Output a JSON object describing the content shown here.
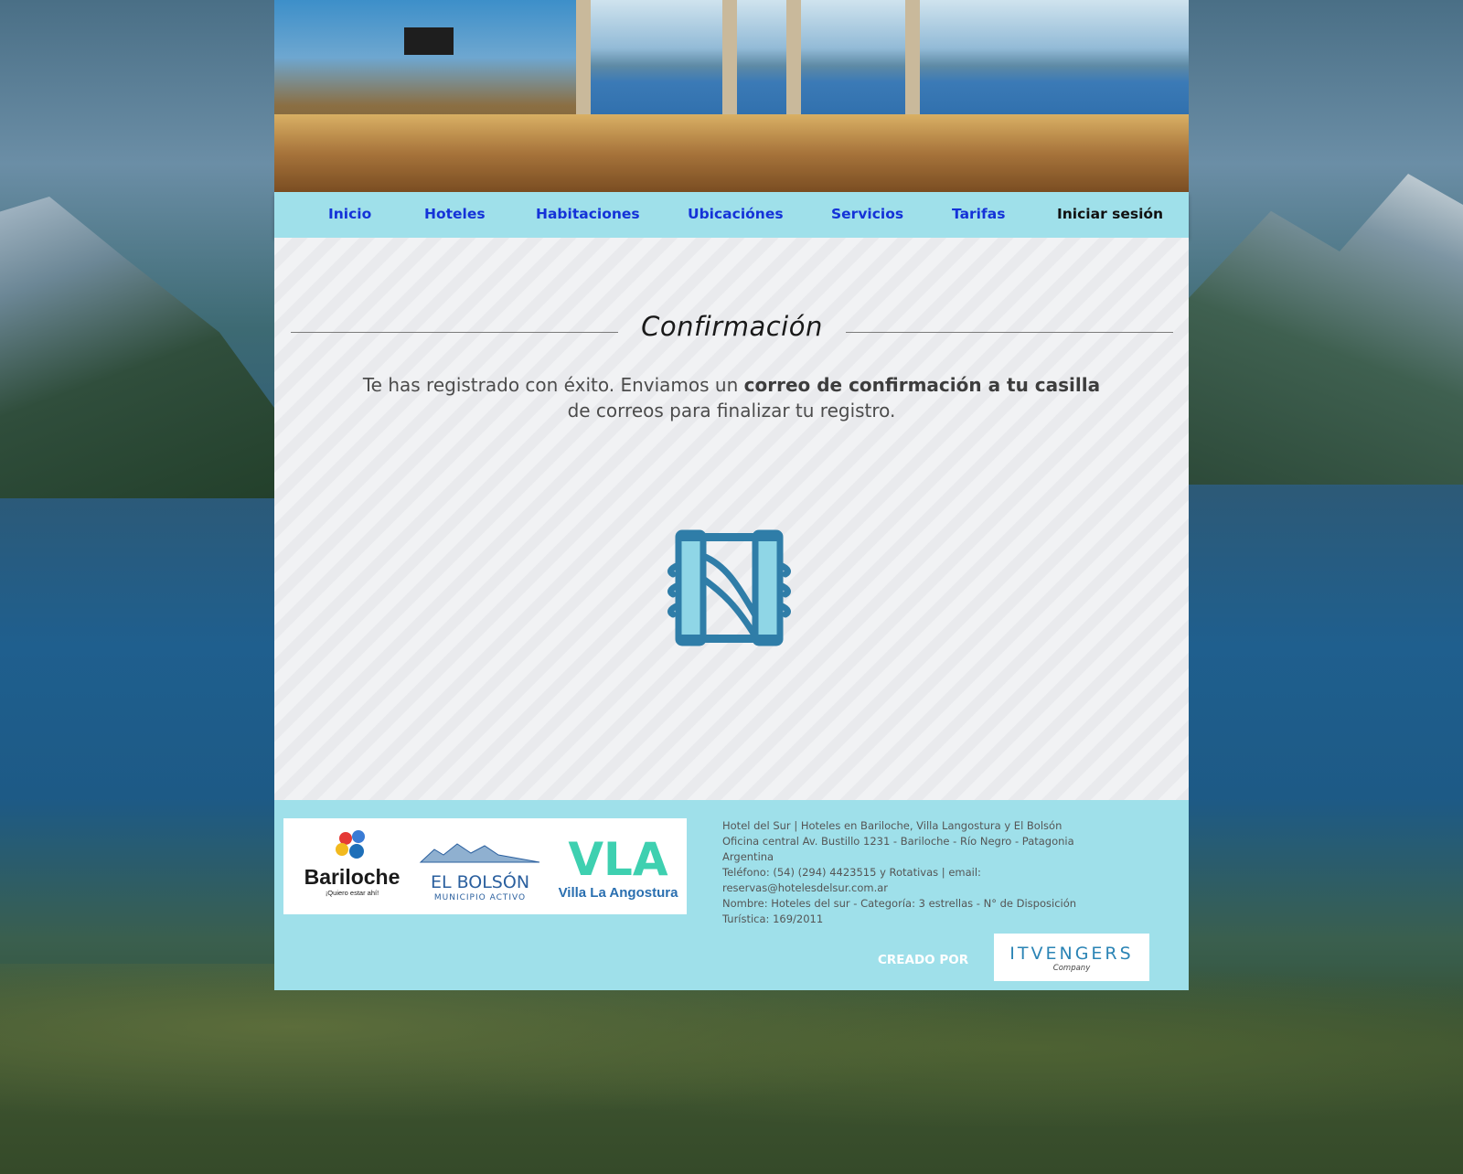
{
  "nav": {
    "items": [
      "Inicio",
      "Hoteles",
      "Habitaciones",
      "Ubicaciónes",
      "Servicios",
      "Tarifas"
    ],
    "login": "Iniciar sesión"
  },
  "main": {
    "title": "Confirmación",
    "message_part1": "Te has registrado con éxito. Enviamos un ",
    "message_bold": "correo de confirmación a tu casilla",
    "message_part2": " de correos para finalizar tu registro."
  },
  "footer": {
    "logos": {
      "bariloche": "Bariloche",
      "bariloche_tagline": "¡Quiero estar ahí!",
      "el_bolson": "EL BOLSÓN",
      "el_bolson_sub": "MUNICIPIO ACTIVO",
      "vla": "VLA",
      "villa_la_angostura": "Villa La Angostura"
    },
    "info_lines": [
      "Hotel del Sur | Hoteles en Bariloche, Villa Langostura y El Bolsón",
      "Oficina central Av. Bustillo 1231 - Bariloche - Río Negro - Patagonia Argentina",
      "Teléfono: (54) (294) 4423515 y Rotativas | email: reservas@hotelesdelsur.com.ar",
      "Nombre: Hoteles del sur - Categoría: 3 estrellas - N° de Disposición Turística: 169/2011"
    ],
    "created_by": "CREADO POR",
    "itvengers": "ITVENGERS",
    "itvengers_sub": "Company"
  },
  "colors": {
    "accent": "#9fe0ea",
    "nav_link": "#1432d8",
    "logo_blue": "#2f7da8"
  }
}
